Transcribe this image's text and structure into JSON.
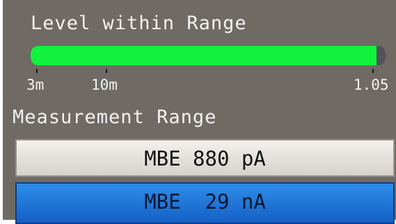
{
  "level": {
    "title": "Level within Range",
    "fill_fraction": 0.975,
    "colors": {
      "fill": "#11f23c",
      "track": "#55515a"
    },
    "scale": [
      {
        "label": "3m"
      },
      {
        "label": "10m"
      },
      {
        "label": "1.05"
      }
    ]
  },
  "range": {
    "title": "Measurement Range",
    "options": [
      {
        "label": "MBE 880 pA",
        "selected": false
      },
      {
        "label": "MBE  29 nA",
        "selected": true
      }
    ],
    "colors": {
      "selected": "#1e73d8",
      "unselected": "#e6e3df"
    }
  }
}
